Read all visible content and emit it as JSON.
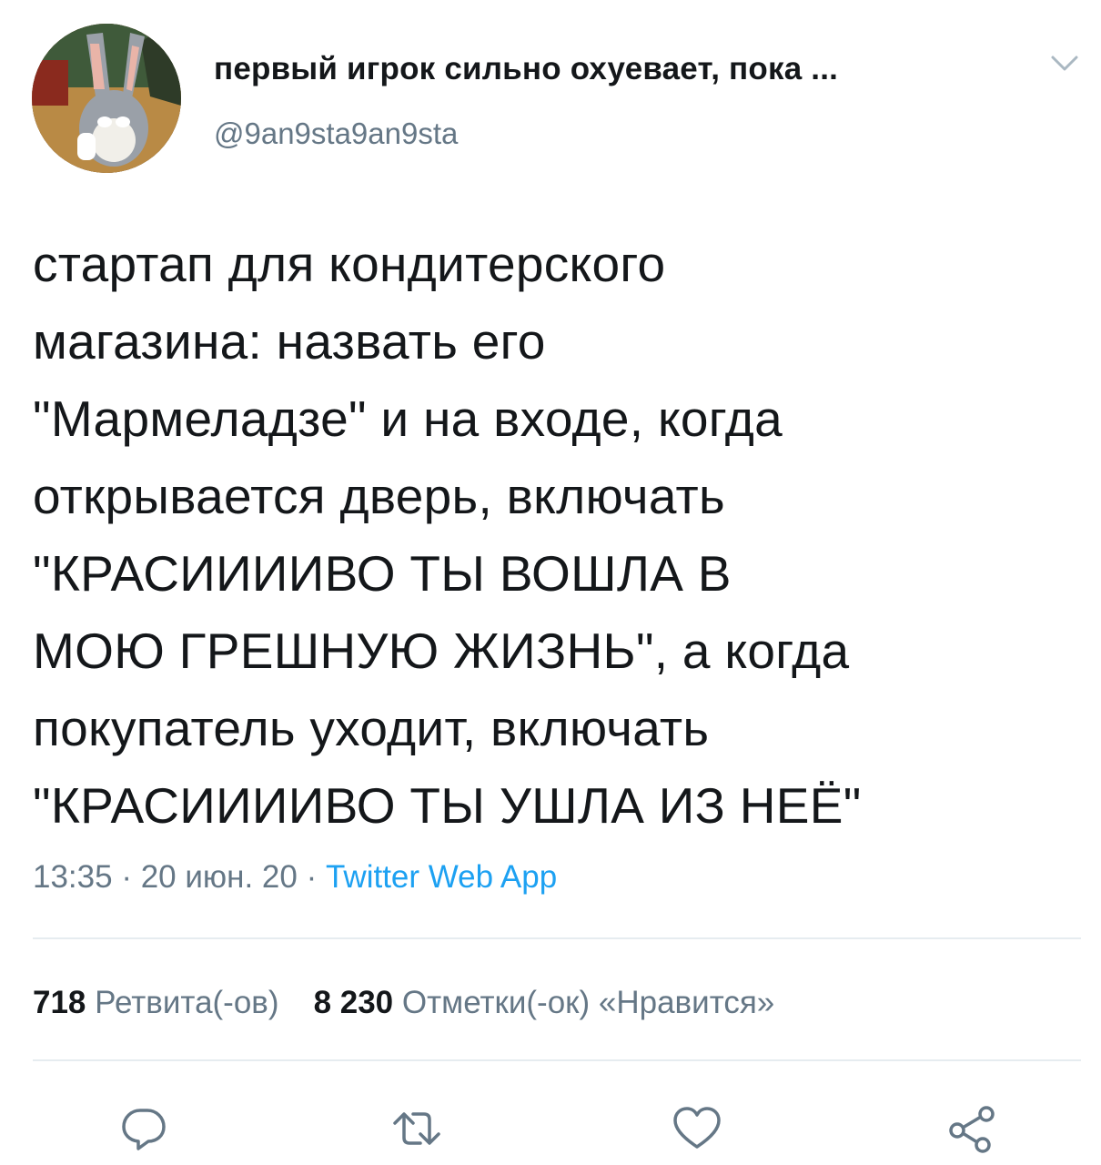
{
  "author": {
    "display_name": "первый игрок сильно охуевает, пока ...",
    "handle": "@9an9sta9an9sta"
  },
  "tweet": {
    "text": "стартап для кондитерского\nмагазина: назвать его\n\"Мармеладзе\" и на входе, когда\nоткрывается дверь, включать\n\"КРАСИИИИВО ТЫ ВОШЛА В\nМОЮ ГРЕШНУЮ ЖИЗНЬ\", а когда\nпокупатель уходит, включать\n\"КРАСИИИИВО ТЫ УШЛА ИЗ НЕЁ\"",
    "time": "13:35",
    "sep": " · ",
    "date": "20 июн. 20",
    "source": "Twitter Web App"
  },
  "stats": {
    "retweets_count": "718",
    "retweets_label": "Ретвита(-ов)",
    "likes_count": "8 230",
    "likes_label": "Отметки(-ок) «Нравится»"
  },
  "icons": {
    "menu": "chevron-down-icon",
    "reply": "reply-icon",
    "retweet": "retweet-icon",
    "like": "heart-icon",
    "share": "share-icon"
  },
  "colors": {
    "text": "#14171a",
    "secondary": "#657786",
    "link": "#1da1f2",
    "divider": "#e6ecf0"
  }
}
